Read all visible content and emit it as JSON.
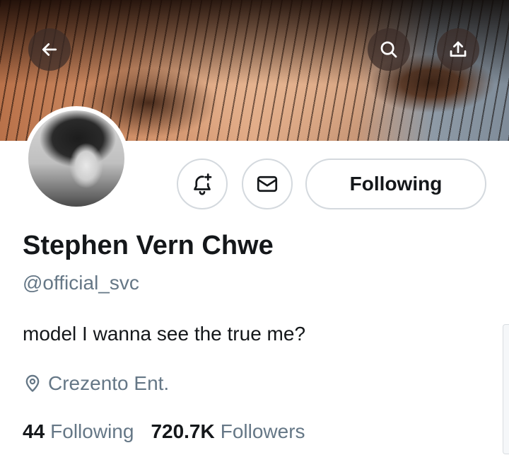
{
  "header": {
    "back_icon": "arrow-left-icon",
    "search_icon": "search-icon",
    "share_icon": "share-upload-icon"
  },
  "profile": {
    "display_name": "Stephen Vern Chwe",
    "handle": "@official_svc",
    "bio": "model I wanna see the true me?",
    "location": "Crezento Ent.",
    "location_icon": "location-pin-icon"
  },
  "actions": {
    "notify_icon": "bell-plus-icon",
    "message_icon": "envelope-icon",
    "follow_label": "Following"
  },
  "stats": {
    "following_count": "44",
    "following_label": "Following",
    "followers_count": "720.7K",
    "followers_label": "Followers"
  },
  "colors": {
    "text_primary": "#14171a",
    "text_secondary": "#657786",
    "border": "#d4d9de"
  }
}
